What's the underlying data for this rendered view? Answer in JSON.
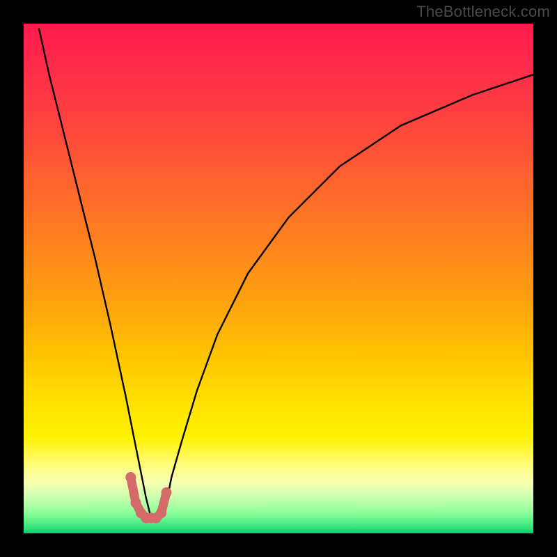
{
  "watermark": "TheBottleneck.com",
  "chart_data": {
    "type": "line",
    "title": "",
    "xlabel": "",
    "ylabel": "",
    "xlim": [
      0,
      100
    ],
    "ylim": [
      0,
      100
    ],
    "gradient_stops": [
      {
        "pos": 0,
        "color": "#ff1a4d"
      },
      {
        "pos": 18,
        "color": "#ff4040"
      },
      {
        "pos": 42,
        "color": "#ff8020"
      },
      {
        "pos": 64,
        "color": "#ffc000"
      },
      {
        "pos": 81,
        "color": "#fff200"
      },
      {
        "pos": 93,
        "color": "#c8ffb0"
      },
      {
        "pos": 100,
        "color": "#18c86a"
      }
    ],
    "series": [
      {
        "name": "bottleneck-curve",
        "color": "#000000",
        "x": [
          3,
          5,
          8,
          11,
          14,
          17,
          20,
          21,
          22,
          23,
          24,
          25,
          26,
          27,
          28,
          29,
          31,
          34,
          38,
          44,
          52,
          62,
          74,
          88,
          100
        ],
        "values": [
          99,
          90,
          78,
          66,
          54,
          41,
          27,
          22,
          17,
          12,
          7,
          3,
          3,
          3,
          6,
          11,
          18,
          28,
          39,
          51,
          62,
          72,
          80,
          86,
          90
        ]
      },
      {
        "name": "valley-highlight",
        "color": "#d56a6a",
        "x": [
          21,
          22,
          23,
          24,
          25,
          26,
          27,
          28
        ],
        "values": [
          11,
          6,
          4,
          3,
          3,
          3,
          4,
          8
        ]
      }
    ],
    "annotations": []
  }
}
